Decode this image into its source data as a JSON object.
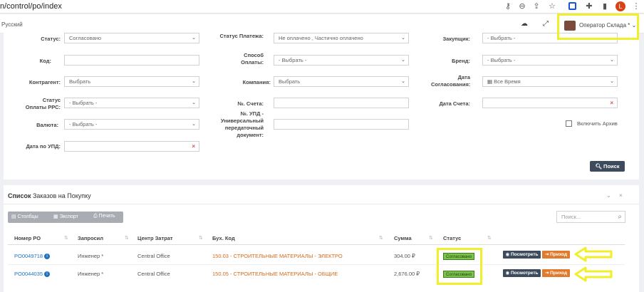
{
  "browser": {
    "url": "n/control/po/index",
    "avatar_letter": "L"
  },
  "header": {
    "language": "Русский",
    "user_name": "Оператор Склада *"
  },
  "filters": {
    "status_label": "Статус:",
    "status_value": "Согласовано",
    "payment_status_label": "Статус Платежа:",
    "payment_status_value": "Не оплачено , Частично оплачено",
    "buyer_label": "Закупщик:",
    "buyer_value": "- Выбрать -",
    "code_label": "Код:",
    "code_value": "",
    "payment_method_label": "Способ Оплаты:",
    "payment_method_value": "- Выбрать -",
    "brand_label": "Бренд:",
    "brand_value": "- Выбрать -",
    "counterparty_label": "Контрагент:",
    "counterparty_value": "Выбрать",
    "company_label": "Компания:",
    "company_value": "Выбрать",
    "approval_date_label": "Дата Согласования:",
    "approval_date_value": "Все Время",
    "rps_status_label": "Статус Оплаты РРС:",
    "rps_status_value": "- Выбрать -",
    "invoice_no_label": "№. Счета:",
    "invoice_no_value": "",
    "invoice_date_label": "Дата Счета:",
    "invoice_date_value": "",
    "currency_label": "Валюта:",
    "currency_value": "- Выбрать -",
    "upd_no_label": "№. УПД - Универсальный передаточный документ:",
    "upd_no_value": "",
    "archive_label": "Включить Архив",
    "upd_date_label": "Дата по УПД:",
    "upd_date_value": "",
    "search_button": "Поиск"
  },
  "list": {
    "title_bold": "Список",
    "title_rest": " Заказов на Покупку",
    "toolbar": {
      "columns": "Столбцы",
      "export": "Экспорт",
      "print": "Печать"
    },
    "search_placeholder": "Поиск...",
    "columns": [
      "Номер PO",
      "Запросил",
      "Центр Затрат",
      "Бух. Код",
      "Сумма",
      "Статус"
    ],
    "rows": [
      {
        "po": "PO0049718",
        "requester": "Инженер *",
        "cost_center": "Central Office",
        "account_code": "150.03 - СТРОИТЕЛЬНЫЕ МАТЕРИАЛЫ - ЭЛЕКТРО",
        "amount": "304.00 ₽",
        "status": "Согласовано",
        "view": "Посмотреть",
        "receive": "Приход"
      },
      {
        "po": "PO0044035",
        "requester": "Инженер *",
        "cost_center": "Central Office",
        "account_code": "150.05 - СТРОИТЕЛЬНЫЕ МАТЕРИАЛЫ - ОБЩИЕ",
        "amount": "2,676.00 ₽",
        "status": "Согласовано",
        "view": "Посмотреть",
        "receive": "Приход"
      }
    ]
  },
  "colors": {
    "highlight": "#f1ee2a",
    "dark_button": "#3d4b5c",
    "orange_button": "#e07a2c",
    "status_green": "#7cc34b",
    "link_blue": "#1e73be"
  }
}
